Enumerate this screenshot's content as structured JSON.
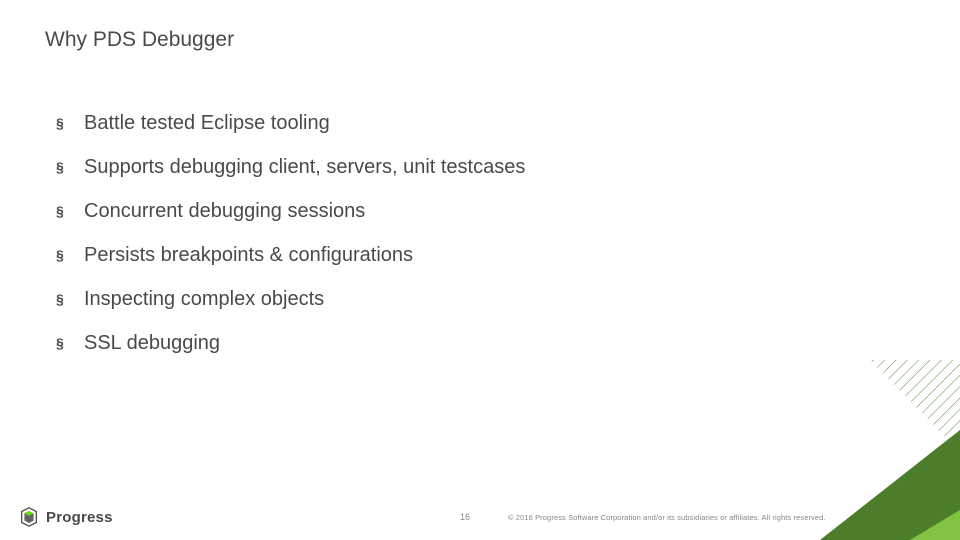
{
  "title": "Why PDS Debugger",
  "bullets": [
    "Battle tested Eclipse tooling",
    "Supports debugging client, servers, unit testcases",
    "Concurrent debugging sessions",
    "Persists breakpoints & configurations",
    "Inspecting complex objects",
    "SSL debugging"
  ],
  "bullet_marker": "§",
  "logo_text": "Progress",
  "page_number": "16",
  "copyright": "© 2016 Progress Software Corporation and/or its subsidiaries or affiliates. All rights reserved.",
  "colors": {
    "accent_dark": "#4b7d2a",
    "accent_light": "#82c341"
  }
}
